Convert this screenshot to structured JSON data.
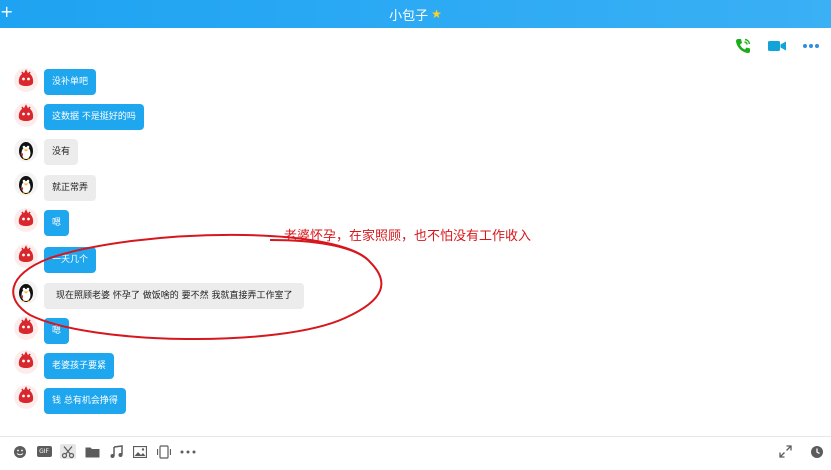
{
  "window": {
    "title": "小包子",
    "title_star": "★",
    "plus_glyph": "+"
  },
  "top_actions": [
    {
      "name": "voice-call",
      "icon": "phone-icon",
      "color": "#1aad19"
    },
    {
      "name": "video-call",
      "icon": "video-camera-icon",
      "color": "#12a3d8"
    },
    {
      "name": "more",
      "icon": "more-dots-icon",
      "color": "#2f8ee0"
    }
  ],
  "messages": [
    {
      "sender": "contact",
      "avatar": "red-character-avatar",
      "text": "没补单吧"
    },
    {
      "sender": "contact",
      "avatar": "red-character-avatar",
      "text": "这数据 不是挺好的吗"
    },
    {
      "sender": "self",
      "avatar": "penguin-avatar",
      "text": "没有"
    },
    {
      "sender": "self",
      "avatar": "penguin-avatar",
      "text": "就正常弄"
    },
    {
      "sender": "contact",
      "avatar": "red-character-avatar",
      "text": "嗯"
    },
    {
      "sender": "contact",
      "avatar": "red-character-avatar",
      "text": "一天几个"
    },
    {
      "sender": "self",
      "avatar": "penguin-avatar",
      "text": "现在照顾老婆 怀孕了 做饭啥的    要不然 我就直接弄工作室了"
    },
    {
      "sender": "contact",
      "avatar": "red-character-avatar",
      "text": "嗯"
    },
    {
      "sender": "contact",
      "avatar": "red-character-avatar",
      "text": "老婆孩子要紧"
    },
    {
      "sender": "contact",
      "avatar": "red-character-avatar",
      "text": "钱 总有机会挣得"
    }
  ],
  "annotation": {
    "text": "老婆怀孕，在家照顾，也不怕没有工作收入",
    "color": "#d6171d"
  },
  "toolbar": {
    "left": [
      {
        "icon": "emoji-icon"
      },
      {
        "icon": "gif-icon",
        "label": "GIF"
      },
      {
        "icon": "scissors-icon"
      },
      {
        "icon": "folder-icon"
      },
      {
        "icon": "music-icon"
      },
      {
        "icon": "image-icon"
      },
      {
        "icon": "screen-share-icon"
      },
      {
        "icon": "more-horizontal-icon"
      }
    ],
    "right": [
      {
        "icon": "expand-icon"
      },
      {
        "icon": "clock-history-icon"
      }
    ]
  },
  "colors": {
    "title_bar": "#1ea3f2",
    "bubble_contact": "#1ea6ef",
    "bubble_self": "#ececec"
  }
}
